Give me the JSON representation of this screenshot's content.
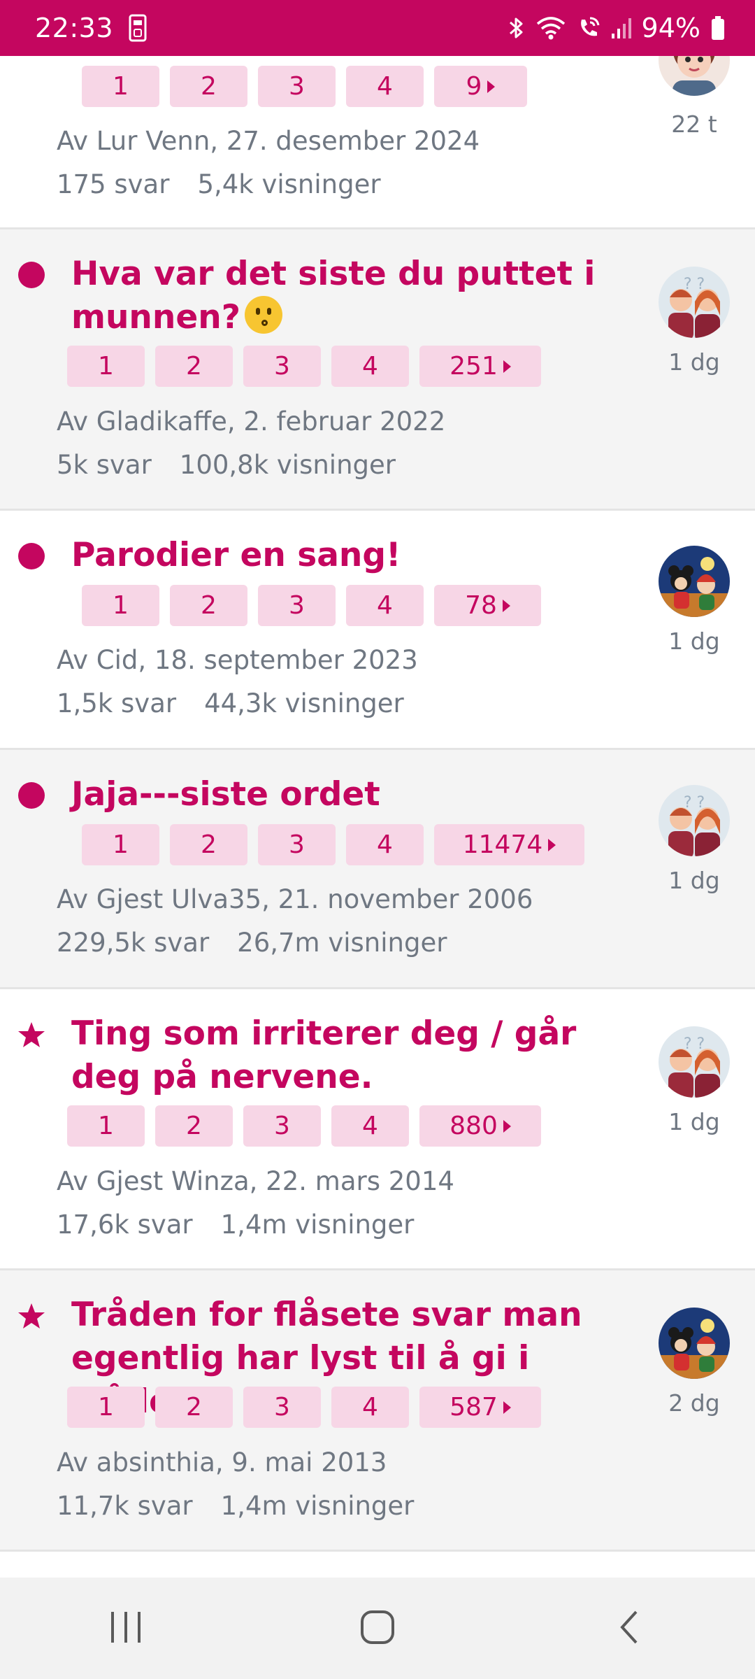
{
  "status_bar": {
    "time": "22:33",
    "battery": "94%",
    "icons": [
      "sim-card-icon",
      "bluetooth-icon",
      "wifi-icon",
      "wifi-calling-icon",
      "signal-icon",
      "battery-icon"
    ]
  },
  "threads": [
    {
      "title": "",
      "marker": "none",
      "pages": [
        "1",
        "2",
        "3",
        "4",
        "9"
      ],
      "author": "Av Lur Venn, 27. desember 2024",
      "replies": "175 svar",
      "views": "5,4k visninger",
      "age": "22 t",
      "avatar": "woman-avatar"
    },
    {
      "title": "Hva var det siste du puttet i munnen?",
      "emoji": "kissing-face-emoji",
      "marker": "dot",
      "pages": [
        "1",
        "2",
        "3",
        "4",
        "251"
      ],
      "author": "Av Gladikaffe, 2. februar 2022",
      "replies": "5k svar",
      "views": "100,8k visninger",
      "age": "1 dg",
      "avatar": "couple-avatar"
    },
    {
      "title": "Parodier en sang!",
      "marker": "dot",
      "pages": [
        "1",
        "2",
        "3",
        "4",
        "78"
      ],
      "author": "Av Cid, 18. september 2023",
      "replies": "1,5k svar",
      "views": "44,3k visninger",
      "age": "1 dg",
      "avatar": "cartoon-avatar"
    },
    {
      "title": "Jaja---siste ordet",
      "marker": "dot",
      "pages": [
        "1",
        "2",
        "3",
        "4",
        "11474"
      ],
      "author": "Av Gjest Ulva35, 21. november 2006",
      "replies": "229,5k svar",
      "views": "26,7m visninger",
      "age": "1 dg",
      "avatar": "couple-avatar"
    },
    {
      "title": "Ting som irriterer deg / går deg på nervene.",
      "marker": "star",
      "pages": [
        "1",
        "2",
        "3",
        "4",
        "880"
      ],
      "author": "Av Gjest Winza, 22. mars 2014",
      "replies": "17,6k svar",
      "views": "1,4m visninger",
      "age": "1 dg",
      "avatar": "couple-avatar"
    },
    {
      "title": "Tråden for flåsete svar man egentlig har lyst til å gi i tråder.",
      "marker": "star",
      "pages": [
        "1",
        "2",
        "3",
        "4",
        "587"
      ],
      "author": "Av absinthia, 9. mai 2013",
      "replies": "11,7k svar",
      "views": "1,4m visninger",
      "age": "2 dg",
      "avatar": "cartoon-avatar"
    }
  ],
  "nav": [
    "recent-apps-icon",
    "home-icon",
    "back-icon"
  ],
  "colors": {
    "brand": "#c4065f",
    "page_chip_bg": "#f7d6e6",
    "meta_text": "#6f7782",
    "alt_row_bg": "#f4f4f4"
  }
}
